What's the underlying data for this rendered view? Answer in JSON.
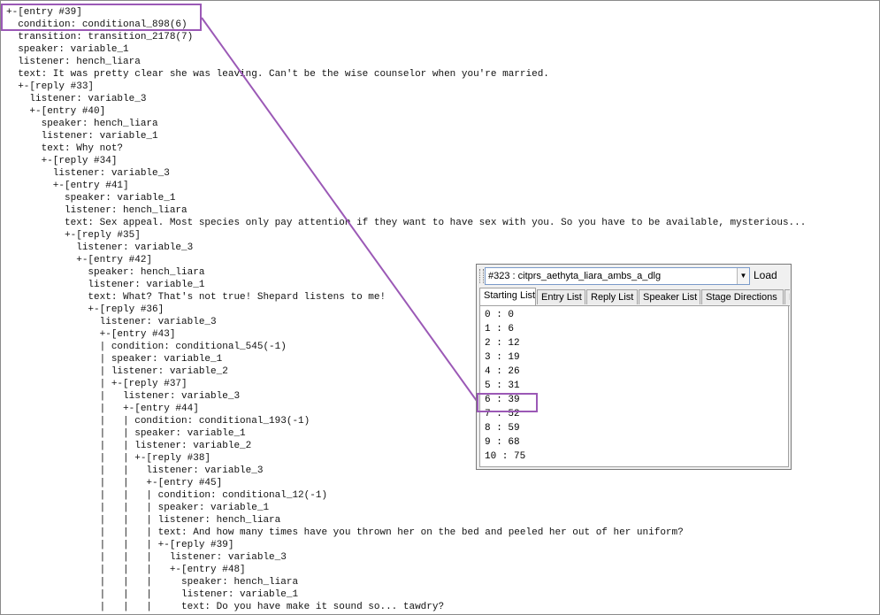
{
  "tree_lines": [
    "+-[entry #39]",
    "  condition: conditional_898(6)",
    "  transition: transition_2178(7)",
    "  speaker: variable_1",
    "  listener: hench_liara",
    "  text: It was pretty clear she was leaving. Can't be the wise counselor when you're married.",
    "  +-[reply #33]",
    "    listener: variable_3",
    "    +-[entry #40]",
    "      speaker: hench_liara",
    "      listener: variable_1",
    "      text: Why not?",
    "      +-[reply #34]",
    "        listener: variable_3",
    "        +-[entry #41]",
    "          speaker: variable_1",
    "          listener: hench_liara",
    "          text: Sex appeal. Most species only pay attention if they want to have sex with you. So you have to be available, mysterious...",
    "          +-[reply #35]",
    "            listener: variable_3",
    "            +-[entry #42]",
    "              speaker: hench_liara",
    "              listener: variable_1",
    "              text: What? That's not true! Shepard listens to me!",
    "              +-[reply #36]",
    "                listener: variable_3",
    "                +-[entry #43]",
    "                | condition: conditional_545(-1)",
    "                | speaker: variable_1",
    "                | listener: variable_2",
    "                | +-[reply #37]",
    "                |   listener: variable_3",
    "                |   +-[entry #44]",
    "                |   | condition: conditional_193(-1)",
    "                |   | speaker: variable_1",
    "                |   | listener: variable_2",
    "                |   | +-[reply #38]",
    "                |   |   listener: variable_3",
    "                |   |   +-[entry #45]",
    "                |   |   | condition: conditional_12(-1)",
    "                |   |   | speaker: variable_1",
    "                |   |   | listener: hench_liara",
    "                |   |   | text: And how many times have you thrown her on the bed and peeled her out of her uniform?",
    "                |   |   | +-[reply #39]",
    "                |   |   |   listener: variable_3",
    "                |   |   |   +-[entry #48]",
    "                |   |   |     speaker: hench_liara",
    "                |   |   |     listener: variable_1",
    "                |   |   |     text: Do you have make it sound so... tawdry?"
  ],
  "panel": {
    "dialog_select": "#323 : citprs_aethyta_liara_ambs_a_dlg",
    "dropdown_glyph": "▼",
    "load_label": "Load",
    "tabs": [
      "Starting List",
      "Entry List",
      "Reply List",
      "Speaker List",
      "Stage Directions",
      "M"
    ],
    "active_tab": "Starting List",
    "starting_list": [
      "0 : 0",
      "1 : 6",
      "2 : 12",
      "3 : 19",
      "4 : 26",
      "5 : 31",
      "6 : 39",
      "7 : 52",
      "8 : 59",
      "9 : 68",
      "10 : 75"
    ]
  },
  "annotation": {
    "color": "#9b59b6"
  }
}
